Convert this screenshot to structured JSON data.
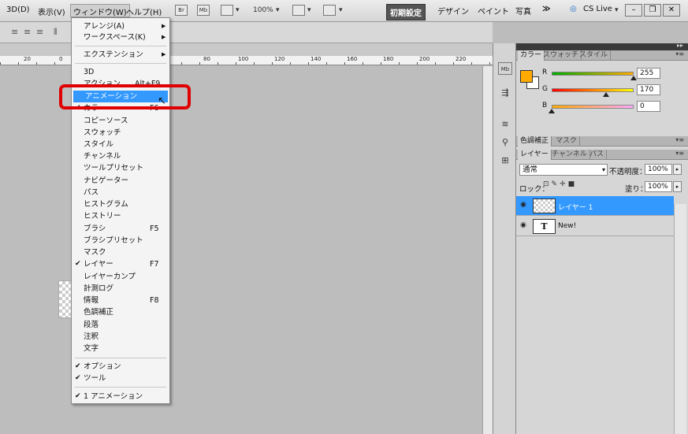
{
  "menubar": {
    "items": [
      "3D(D)",
      "表示(V)",
      "ウィンドウ(W)",
      "ヘルプ(H)"
    ],
    "zoom": "100%",
    "workspaces": [
      "初期設定",
      "デザイン",
      "ペイント",
      "写真"
    ],
    "more": "≫",
    "cslive": "CS Live",
    "app_icons": [
      "Br",
      "Mb"
    ]
  },
  "ruler": {
    "labels": [
      "20",
      "0",
      "80",
      "100",
      "120",
      "140",
      "160",
      "180",
      "200",
      "220"
    ]
  },
  "window_menu": {
    "items": [
      {
        "label": "アレンジ(A)",
        "submenu": true
      },
      {
        "label": "ワークスペース(K)",
        "submenu": true
      },
      {
        "label": "エクステンション",
        "submenu": true
      },
      {
        "label": "3D"
      },
      {
        "label": "アクション",
        "shortcut": "Alt+F9"
      },
      {
        "label": "アニメーション",
        "highlighted": true
      },
      {
        "label": "カラー",
        "shortcut": "F6",
        "checked": true
      },
      {
        "label": "コピーソース"
      },
      {
        "label": "スウォッチ"
      },
      {
        "label": "スタイル"
      },
      {
        "label": "チャンネル"
      },
      {
        "label": "ツールプリセット"
      },
      {
        "label": "ナビゲーター"
      },
      {
        "label": "パス"
      },
      {
        "label": "ヒストグラム"
      },
      {
        "label": "ヒストリー"
      },
      {
        "label": "ブラシ",
        "shortcut": "F5"
      },
      {
        "label": "ブラシプリセット"
      },
      {
        "label": "マスク"
      },
      {
        "label": "レイヤー",
        "shortcut": "F7",
        "checked": true
      },
      {
        "label": "レイヤーカンプ"
      },
      {
        "label": "計測ログ"
      },
      {
        "label": "情報",
        "shortcut": "F8"
      },
      {
        "label": "色調補正"
      },
      {
        "label": "段落"
      },
      {
        "label": "注釈"
      },
      {
        "label": "文字"
      },
      {
        "label": "オプション",
        "checked": true
      },
      {
        "label": "ツール",
        "checked": true
      },
      {
        "label": "1 アニメーション",
        "checked": true
      }
    ]
  },
  "color_panel": {
    "tabs": [
      "カラー",
      "スウォッチ",
      "スタイル"
    ],
    "channels": [
      {
        "label": "R",
        "value": "255",
        "fraction": 1.0
      },
      {
        "label": "G",
        "value": "170",
        "fraction": 0.667
      },
      {
        "label": "B",
        "value": "0",
        "fraction": 0.0
      }
    ],
    "foreground": "#ffaa00",
    "background": "#ffffff"
  },
  "adjust_panel": {
    "tabs": [
      "色調補正",
      "マスク"
    ]
  },
  "layers_panel": {
    "tabs": [
      "レイヤー",
      "チャンネル",
      "パス"
    ],
    "blend_mode": "通常",
    "opacity_label": "不透明度：",
    "opacity": "100%",
    "lock_label": "ロック：",
    "fill_label": "塗り：",
    "fill": "100%",
    "layers": [
      {
        "name": "レイヤー 1",
        "selected": true,
        "kind": "raster"
      },
      {
        "name": "New!",
        "selected": false,
        "kind": "text",
        "thumb_glyph": "T"
      }
    ]
  },
  "colors": {
    "accent": "#3399ff",
    "callout": "#e00000"
  }
}
